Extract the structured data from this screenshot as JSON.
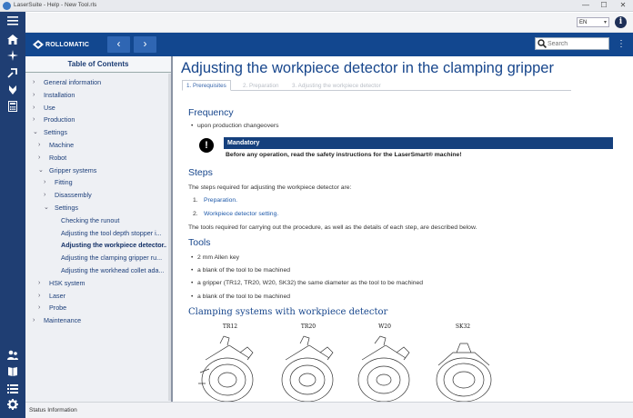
{
  "window": {
    "title": "LaserSuite - Help - New Tool.rls",
    "minimize": "—",
    "maximize": "☐",
    "close": "✕"
  },
  "language": {
    "selected": "EN"
  },
  "header": {
    "logo_text": "ROLLOMATIC",
    "back": "‹",
    "forward": "›",
    "search_placeholder": "Search",
    "menu": "⋮"
  },
  "rail": {
    "icons": [
      "home-icon",
      "laser-icon",
      "tool-icon",
      "grinder-icon",
      "calculator-icon",
      "users-icon",
      "book-icon",
      "list-icon",
      "gear-icon"
    ]
  },
  "toc": {
    "title": "Table of Contents",
    "items": [
      {
        "label": "General information",
        "level": 0,
        "chev": "›"
      },
      {
        "label": "Installation",
        "level": 0,
        "chev": "›"
      },
      {
        "label": "Use",
        "level": 0,
        "chev": "›"
      },
      {
        "label": "Production",
        "level": 0,
        "chev": "›"
      },
      {
        "label": "Settings",
        "level": 0,
        "chev": "⌄"
      },
      {
        "label": "Machine",
        "level": 1,
        "chev": "›"
      },
      {
        "label": "Robot",
        "level": 1,
        "chev": "›"
      },
      {
        "label": "Gripper systems",
        "level": 1,
        "chev": "⌄"
      },
      {
        "label": "Fitting",
        "level": 2,
        "chev": "›"
      },
      {
        "label": "Disassembly",
        "level": 2,
        "chev": "›"
      },
      {
        "label": "Settings",
        "level": 2,
        "chev": "⌄"
      },
      {
        "label": "Checking the runout",
        "level": 3,
        "chev": ""
      },
      {
        "label": "Adjusting the tool depth stopper i...",
        "level": 3,
        "chev": ""
      },
      {
        "label": "Adjusting the workpiece detector...",
        "level": 3,
        "chev": "",
        "active": true
      },
      {
        "label": "Adjusting the clamping gripper ru...",
        "level": 3,
        "chev": ""
      },
      {
        "label": "Adjusting the workhead collet ada...",
        "level": 3,
        "chev": ""
      },
      {
        "label": "HSK system",
        "level": 1,
        "chev": "›"
      },
      {
        "label": "Laser",
        "level": 1,
        "chev": "›"
      },
      {
        "label": "Probe",
        "level": 1,
        "chev": "›"
      },
      {
        "label": "Maintenance",
        "level": 0,
        "chev": "›"
      }
    ]
  },
  "content": {
    "title": "Adjusting the workpiece detector in the clamping gripper",
    "tabs": [
      "1. Prerequisites",
      "2. Preparation",
      "3. Adjusting the workpiece detector"
    ],
    "frequency": {
      "heading": "Frequency",
      "bullet": "upon production changeovers"
    },
    "mandatory": {
      "icon": "!",
      "label": "Mandatory",
      "text": "Before any operation, read the safety instructions for the LaserSmart® machine!"
    },
    "steps": {
      "heading": "Steps",
      "intro": "The steps required for adjusting the workpiece detector are:",
      "items": [
        {
          "num": "1.",
          "label": "Preparation."
        },
        {
          "num": "2.",
          "label": "Workpiece detector setting."
        }
      ],
      "outro": "The tools required for carrying out the procedure, as well as the details of each step, are described below."
    },
    "tools": {
      "heading": "Tools",
      "items": [
        "2 mm Allen key",
        "a blank of the tool to be machined",
        "a gripper (TR12, TR20, W20, SK32) the same diameter as the tool to be machined",
        "a blank of the tool to be machined"
      ]
    },
    "clamping": {
      "heading": "Clamping systems with workpiece detector",
      "figures": [
        "TR12",
        "TR20",
        "W20",
        "SK32"
      ]
    }
  },
  "status": {
    "text": "Status Information"
  }
}
